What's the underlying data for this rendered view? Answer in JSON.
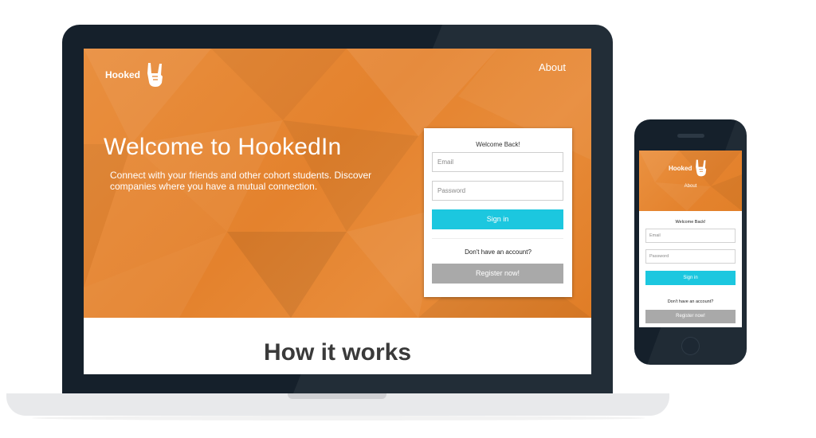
{
  "laptop": {
    "nav": {
      "brand": "Hooked",
      "brand_icon": "rock-hand-icon",
      "about": "About"
    },
    "hero": {
      "title": "Welcome to HookedIn",
      "subtitle": "Connect with your friends and other cohort students. Discover companies where you have a mutual connection."
    },
    "login": {
      "welcome": "Welcome Back!",
      "email_placeholder": "Email",
      "password_placeholder": "Password",
      "signin_label": "Sign in",
      "no_account": "Don't have an account?",
      "register_label": "Register now!"
    },
    "section_title": "How it works"
  },
  "phone": {
    "nav": {
      "brand": "Hooked",
      "brand_icon": "rock-hand-icon",
      "about": "About"
    },
    "login": {
      "welcome": "Welcome Back!",
      "email_placeholder": "Email",
      "password_placeholder": "Password",
      "signin_label": "Sign in",
      "no_account": "Don't have an account?",
      "register_label": "Register now!"
    }
  },
  "colors": {
    "hero_orange": "#e4822d",
    "signin_cyan": "#1cc7df",
    "register_gray": "#a9a9a9",
    "device_frame": "#15202b"
  }
}
